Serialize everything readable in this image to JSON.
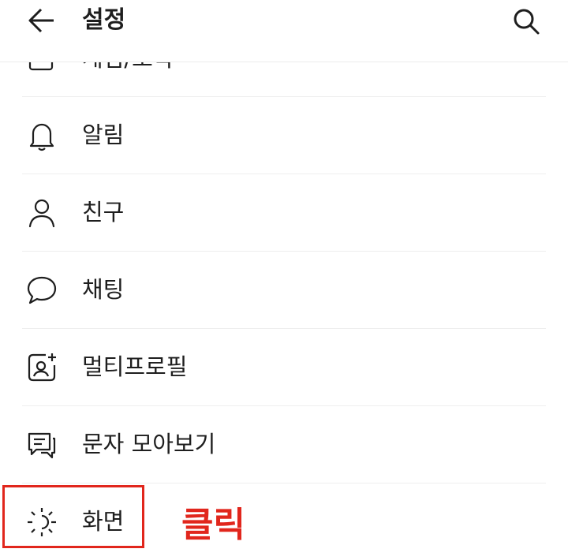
{
  "header": {
    "title": "설정"
  },
  "list": {
    "partial_item": {
      "label": "게임/오락"
    },
    "items": [
      {
        "label": "알림",
        "icon": "bell-icon"
      },
      {
        "label": "친구",
        "icon": "person-icon"
      },
      {
        "label": "채팅",
        "icon": "chat-bubble-icon"
      },
      {
        "label": "멀티프로필",
        "icon": "multi-profile-icon"
      },
      {
        "label": "문자 모아보기",
        "icon": "message-collect-icon"
      },
      {
        "label": "화면",
        "icon": "display-sun-icon"
      }
    ]
  },
  "annotation": {
    "text": "클릭",
    "color": "#e1261c"
  }
}
